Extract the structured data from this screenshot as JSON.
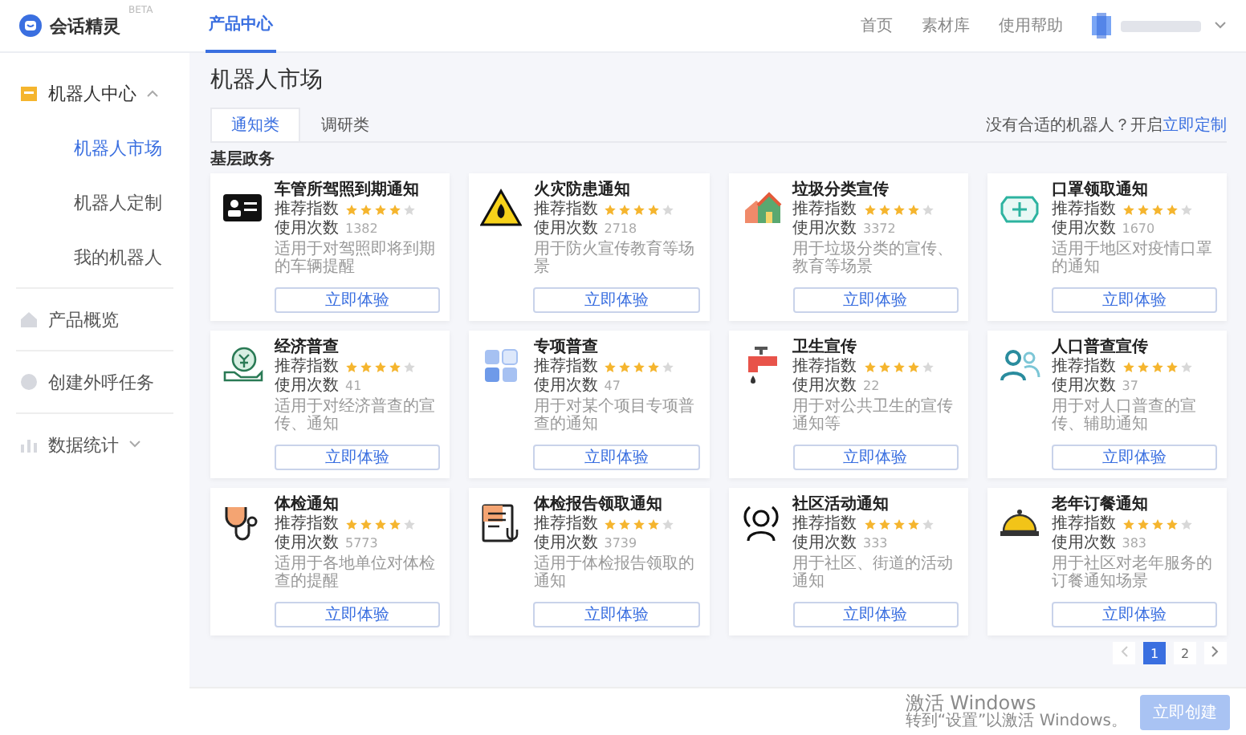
{
  "header": {
    "logo_text": "会话精灵",
    "badge": "BETA",
    "nav": [
      {
        "label": "产品中心",
        "selected": true
      }
    ],
    "links": [
      "首页",
      "素材库",
      "使用帮助"
    ]
  },
  "sidebar": {
    "items": [
      {
        "label": "机器人中心",
        "expanded": true,
        "children": [
          {
            "label": "机器人市场",
            "selected": true
          },
          {
            "label": "机器人定制",
            "selected": false
          },
          {
            "label": "我的机器人",
            "selected": false
          }
        ]
      },
      {
        "label": "产品概览"
      },
      {
        "label": "创建外呼任务"
      },
      {
        "label": "数据统计",
        "expanded": false
      }
    ]
  },
  "page_title": "机器人市场",
  "tabs": [
    {
      "label": "通知类",
      "selected": true
    },
    {
      "label": "调研类",
      "selected": false
    }
  ],
  "hint": {
    "text": "没有合适的机器人？开启",
    "link": "立即定制"
  },
  "section_title": "基层政务",
  "cards": [
    {
      "title": "车管所驾照到期通知",
      "rating_label": "推荐指数",
      "stars": 4,
      "usage_label": "使用次数",
      "usage": "1382",
      "description": "适用于对驾照即将到期的车辆提醒",
      "button": "立即体验"
    },
    {
      "title": "火灾防患通知",
      "rating_label": "推荐指数",
      "stars": 4,
      "usage_label": "使用次数",
      "usage": "2718",
      "description": "用于防火宣传教育等场景",
      "button": "立即体验"
    },
    {
      "title": "垃圾分类宣传",
      "rating_label": "推荐指数",
      "stars": 4,
      "usage_label": "使用次数",
      "usage": "3372",
      "description": "用于垃圾分类的宣传、教育等场景",
      "button": "立即体验"
    },
    {
      "title": "口罩领取通知",
      "rating_label": "推荐指数",
      "stars": 4,
      "usage_label": "使用次数",
      "usage": "1670",
      "description": "适用于地区对疫情口罩的通知",
      "button": "立即体验"
    },
    {
      "title": "经济普查",
      "rating_label": "推荐指数",
      "stars": 4,
      "usage_label": "使用次数",
      "usage": "41",
      "description": "适用于对经济普查的宣传、通知",
      "button": "立即体验"
    },
    {
      "title": "专项普查",
      "rating_label": "推荐指数",
      "stars": 4,
      "usage_label": "使用次数",
      "usage": "47",
      "description": "用于对某个项目专项普查的通知",
      "button": "立即体验"
    },
    {
      "title": "卫生宣传",
      "rating_label": "推荐指数",
      "stars": 4,
      "usage_label": "使用次数",
      "usage": "22",
      "description": "用于对公共卫生的宣传通知等",
      "button": "立即体验"
    },
    {
      "title": "人口普查宣传",
      "rating_label": "推荐指数",
      "stars": 4,
      "usage_label": "使用次数",
      "usage": "37",
      "description": "用于对人口普查的宣传、辅助通知",
      "button": "立即体验"
    },
    {
      "title": "体检通知",
      "rating_label": "推荐指数",
      "stars": 4,
      "usage_label": "使用次数",
      "usage": "5773",
      "description": "适用于各地单位对体检查的提醒",
      "button": "立即体验"
    },
    {
      "title": "体检报告领取通知",
      "rating_label": "推荐指数",
      "stars": 4,
      "usage_label": "使用次数",
      "usage": "3739",
      "description": "适用于体检报告领取的通知",
      "button": "立即体验"
    },
    {
      "title": "社区活动通知",
      "rating_label": "推荐指数",
      "stars": 4,
      "usage_label": "使用次数",
      "usage": "333",
      "description": "用于社区、街道的活动通知",
      "button": "立即体验"
    },
    {
      "title": "老年订餐通知",
      "rating_label": "推荐指数",
      "stars": 4,
      "usage_label": "使用次数",
      "usage": "383",
      "description": "用于社区对老年服务的订餐通知场景",
      "button": "立即体验"
    }
  ],
  "pagination": {
    "pages": [
      {
        "label": "1",
        "selected": true
      },
      {
        "label": "2",
        "selected": false
      }
    ]
  },
  "os_notice": {
    "title": "激活 Windows",
    "text": "转到“设置”以激活 Windows。"
  },
  "footer_button": "立即创建"
}
